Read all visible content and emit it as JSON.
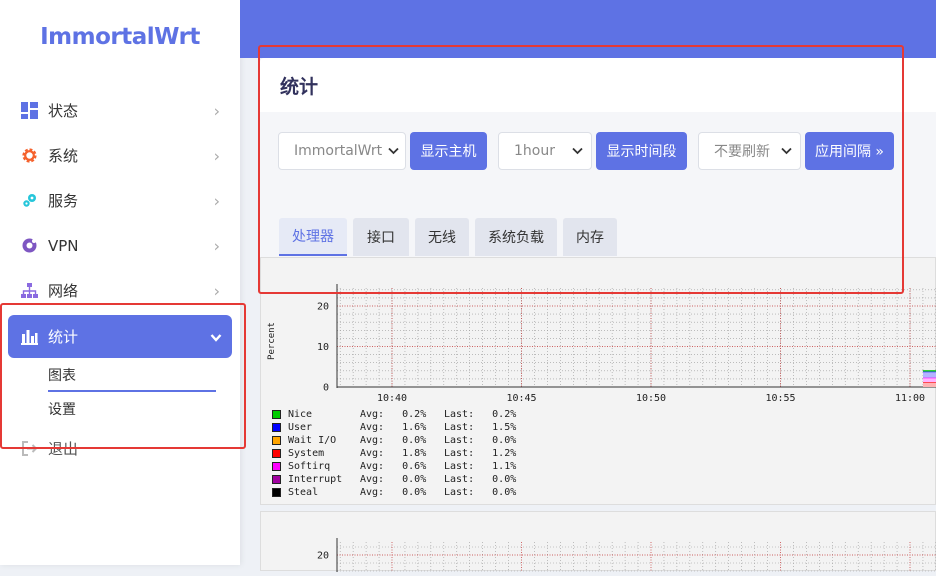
{
  "brand": "ImmortalWrt",
  "sidebar": {
    "items": [
      {
        "label": "状态",
        "icon": "dashboard-icon",
        "color": "#5e72e4"
      },
      {
        "label": "系统",
        "icon": "gear-icon",
        "color": "#f5622d"
      },
      {
        "label": "服务",
        "icon": "puzzle-icon",
        "color": "#26c6da"
      },
      {
        "label": "VPN",
        "icon": "vpn-icon",
        "color": "#7e57c2"
      },
      {
        "label": "网络",
        "icon": "network-icon",
        "color": "#8a6ae0"
      },
      {
        "label": "统计",
        "icon": "bar-chart-icon",
        "color": "#ffffff"
      }
    ],
    "stats_sub": [
      {
        "label": "图表"
      },
      {
        "label": "设置"
      }
    ],
    "logout": {
      "label": "退出"
    }
  },
  "page": {
    "title": "统计",
    "controls": {
      "host_select": "ImmortalWrt",
      "host_button": "显示主机",
      "timespan_select": "1hour",
      "timespan_button": "显示时间段",
      "refresh_select": "不要刷新",
      "interval_button": "应用间隔 »"
    },
    "tabs": [
      "处理器",
      "接口",
      "无线",
      "系统负载",
      "内存"
    ],
    "active_tab": 0
  },
  "colors": {
    "accent": "#5e72e4",
    "highlight": "#e53935"
  },
  "chart_data": [
    {
      "type": "area",
      "ylabel": "Percent",
      "yticks": [
        0,
        10,
        20
      ],
      "ylim": [
        0,
        25
      ],
      "x_ticks": [
        "10:40",
        "10:45",
        "10:50",
        "10:55",
        "11:00"
      ],
      "series": [
        {
          "name": "Nice",
          "color": "#00cc00",
          "avg": "0.2%",
          "last": "0.2%"
        },
        {
          "name": "User",
          "color": "#0000ff",
          "avg": "1.6%",
          "last": "1.5%"
        },
        {
          "name": "Wait I/O",
          "color": "#ffa500",
          "avg": "0.0%",
          "last": "0.0%"
        },
        {
          "name": "System",
          "color": "#ff0000",
          "avg": "1.8%",
          "last": "1.2%"
        },
        {
          "name": "Softirq",
          "color": "#ff00ff",
          "avg": "0.6%",
          "last": "1.1%"
        },
        {
          "name": "Interrupt",
          "color": "#a000a0",
          "avg": "0.0%",
          "last": "0.0%"
        },
        {
          "name": "Steal",
          "color": "#000000",
          "avg": "0.0%",
          "last": "0.0%"
        }
      ]
    },
    {
      "type": "area",
      "yticks": [
        20
      ],
      "ylim": [
        0,
        25
      ]
    }
  ]
}
